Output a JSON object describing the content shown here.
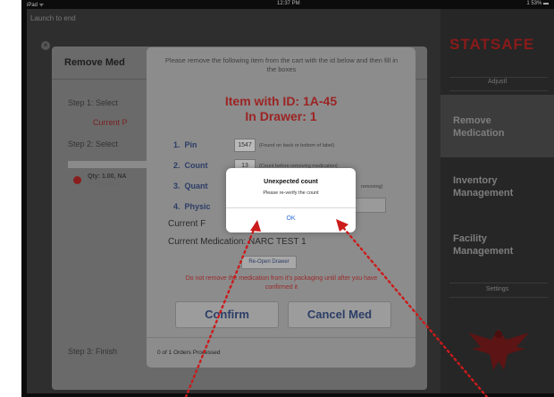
{
  "status_bar": {
    "left": "iPad ᯤ",
    "time": "12:37 PM",
    "right": "1 53% ▬"
  },
  "app": {
    "title": "Launch to end"
  },
  "left_panel": {
    "title": "Remove Med",
    "step1": "Step 1: Select",
    "current_patient": "Current P",
    "step2": "Step 2: Select",
    "qty_text": "Qty: 1.00, NA",
    "qty_sub": "Pending Med",
    "step3": "Step 3: Finish"
  },
  "sidebar": {
    "logo": "STATSAFE",
    "sub1": "Adjustl",
    "items": [
      {
        "label": "Remove\nMedication"
      },
      {
        "label": "Inventory\nManagement"
      },
      {
        "label": "Facility\nManagement"
      }
    ],
    "sub2": "Settings"
  },
  "modal": {
    "instruction": "Please remove the following item from the cart with the id below and then fill in the boxes",
    "item_title": "Item with ID: 1A-45",
    "drawer_title": "In Drawer: 1",
    "fields": [
      {
        "num": "1.",
        "label": "Pin",
        "value": "1547",
        "hint": "(Found on back or bottom of label)"
      },
      {
        "num": "2.",
        "label": "Count",
        "value": "13",
        "hint": "(Count before removing medication)"
      },
      {
        "num": "3.",
        "label": "Quant",
        "hint": "removing)"
      },
      {
        "num": "4.",
        "label": "Physic"
      }
    ],
    "current_f": "Current F",
    "current_medication": "Current Medication: NARC TEST 1",
    "reopen_button": "Re-Open Drawer",
    "warning": "Do not remove the medication from it's packaging until after you have confirmed it",
    "confirm_button": "Confirm",
    "cancel_button": "Cancel Med",
    "orders_processed": "0 of 1 Orders Processed"
  },
  "alert": {
    "title": "Unexpected count",
    "message": "Please re-verify the count",
    "ok": "OK"
  },
  "colors": {
    "accent_red": "#9c2424",
    "button_text": "#2c3d66",
    "alert_ok": "#2f6fd6",
    "arrow_red": "#cc1b1b"
  }
}
